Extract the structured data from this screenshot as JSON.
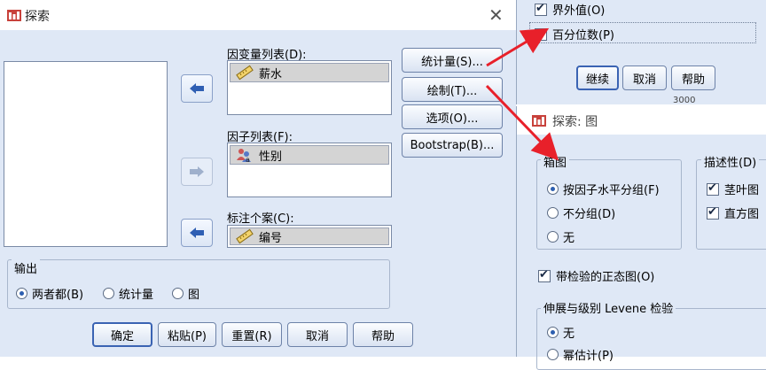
{
  "explore": {
    "title": "探索",
    "close_glyph": "✕",
    "dependent_label": "因变量列表(D):",
    "dependent_items": [
      "薪水"
    ],
    "factor_label": "因子列表(F):",
    "factor_items": [
      "性别"
    ],
    "label_cases_label": "标注个案(C):",
    "label_cases_item": "编号",
    "buttons": {
      "statistics": "统计量(S)...",
      "plots": "绘制(T)...",
      "options": "选项(O)...",
      "bootstrap": "Bootstrap(B)..."
    },
    "output": {
      "legend": "输出",
      "options": [
        "两者都(B)",
        "统计量",
        "图"
      ],
      "selected": "两者都(B)"
    },
    "footer": {
      "ok": "确定",
      "paste": "粘贴(P)",
      "reset": "重置(R)",
      "cancel": "取消",
      "help": "帮助"
    }
  },
  "statistics_dialog": {
    "outliers": "界外值(O)",
    "percentiles": "百分位数(P)",
    "continue": "继续",
    "cancel": "取消",
    "help": "帮助",
    "background_value": "3000"
  },
  "plots_dialog": {
    "title": "探索: 图",
    "boxplots_legend": "箱图",
    "boxplot_options": [
      "按因子水平分组(F)",
      "不分组(D)",
      "无"
    ],
    "boxplot_selected": "按因子水平分组(F)",
    "descriptive_legend": "描述性(D)",
    "descriptive_options": [
      "茎叶图",
      "直方图"
    ],
    "normality_label": "带检验的正态图(O)",
    "levene_legend": "伸展与级别 Levene 检验",
    "levene_options": [
      "无",
      "幂估计(P)"
    ]
  },
  "colors": {
    "annotation_arrow": "#e8202a",
    "dialog_bg": "#dfe8f6",
    "move_arrow": "#2f5fb3"
  }
}
